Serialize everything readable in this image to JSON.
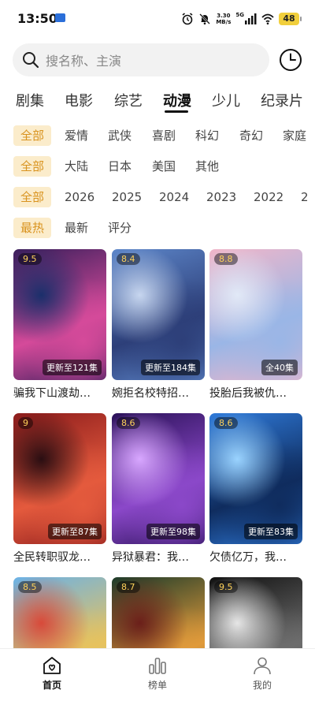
{
  "status": {
    "time": "13:50",
    "speed_value": "3.30",
    "speed_unit": "MB/s",
    "network": "5G",
    "battery": "48"
  },
  "search": {
    "placeholder": "搜名称、主演"
  },
  "tabs": [
    "剧集",
    "电影",
    "综艺",
    "动漫",
    "少儿",
    "纪录片"
  ],
  "active_tab": "动漫",
  "filters": {
    "genre": [
      "全部",
      "爱情",
      "武侠",
      "喜剧",
      "科幻",
      "奇幻",
      "家庭"
    ],
    "region": [
      "全部",
      "大陆",
      "日本",
      "美国",
      "其他"
    ],
    "year": [
      "全部",
      "2026",
      "2025",
      "2024",
      "2023",
      "2022",
      "2"
    ],
    "sort": [
      "最热",
      "最新",
      "评分"
    ]
  },
  "items": [
    {
      "title": "骗我下山渡劫…",
      "score": "9.5",
      "episodes": "更新至121集",
      "colors": [
        "#3a1f5c",
        "#d54a9a",
        "#1b2f6b"
      ]
    },
    {
      "title": "婉拒名校特招…",
      "score": "8.4",
      "episodes": "更新至184集",
      "colors": [
        "#5d86c9",
        "#2d3f79",
        "#c7d6ef"
      ]
    },
    {
      "title": "投胎后我被仇…",
      "score": "8.8",
      "episodes": "全40集",
      "colors": [
        "#f1b6c9",
        "#9ab6e6",
        "#e1e9f7"
      ]
    },
    {
      "title": "全民转职驭龙…",
      "score": "9",
      "episodes": "更新至87集",
      "colors": [
        "#8c1c1c",
        "#e45a3d",
        "#2a0e12"
      ]
    },
    {
      "title": "异狱暴君：我…",
      "score": "8.6",
      "episodes": "更新至98集",
      "colors": [
        "#2b1259",
        "#8b48c9",
        "#d8a7ff"
      ]
    },
    {
      "title": "欠债亿万，我…",
      "score": "8.6",
      "episodes": "更新至83集",
      "colors": [
        "#2f7ad9",
        "#0f2c5e",
        "#9ad3ff"
      ]
    },
    {
      "title": "",
      "score": "8.5",
      "episodes": "",
      "colors": [
        "#6bb2e6",
        "#e7c25d",
        "#d84a3a"
      ]
    },
    {
      "title": "",
      "score": "8.7",
      "episodes": "",
      "colors": [
        "#1d3b2a",
        "#e09a3a",
        "#6b1f1a"
      ]
    },
    {
      "title": "",
      "score": "9.5",
      "episodes": "",
      "colors": [
        "#111111",
        "#6d6d6d",
        "#e6e6e6"
      ]
    }
  ],
  "nav": {
    "home": "首页",
    "rank": "榜单",
    "mine": "我的"
  }
}
